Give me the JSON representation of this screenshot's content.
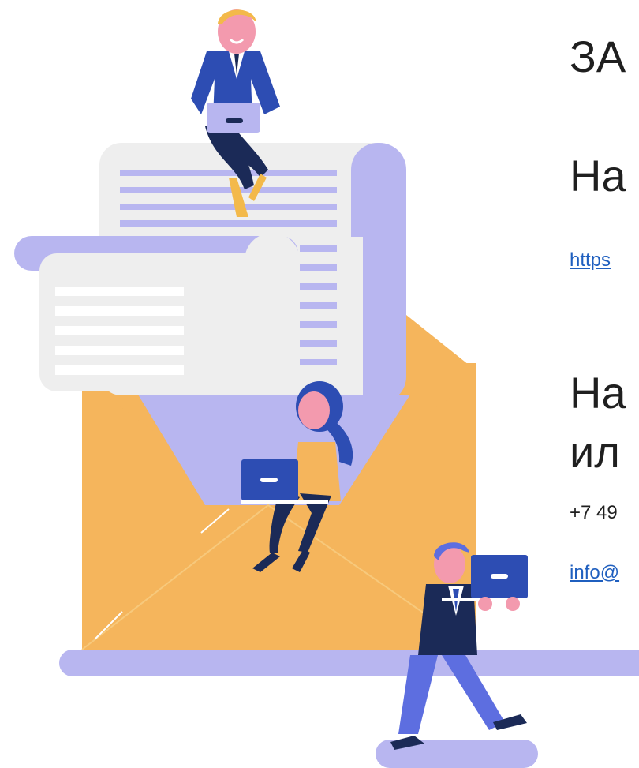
{
  "headings": {
    "line1": "ЗА",
    "line2": "На",
    "line3": "На",
    "line4": "ил"
  },
  "links": {
    "website": "https",
    "email": "info@"
  },
  "contacts": {
    "phone": "+7 49"
  },
  "colors": {
    "envelope": "#F5B55C",
    "lavender": "#B8B6F0",
    "paper": "#EEEEEE",
    "navy": "#1B2A57",
    "blue": "#2D4DB3",
    "skin": "#F39AAE",
    "hair_blond": "#F3B94A",
    "link": "#1F5FBF"
  }
}
